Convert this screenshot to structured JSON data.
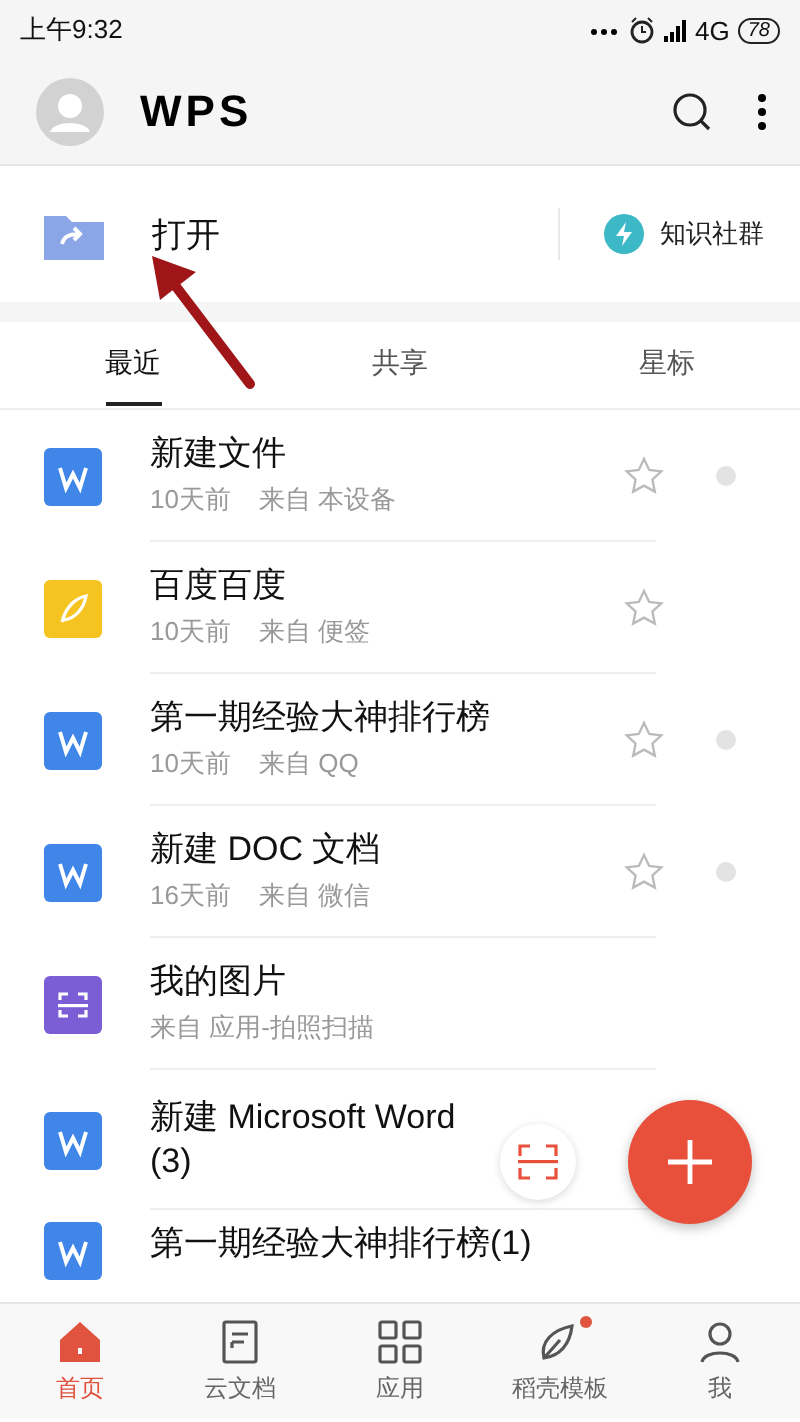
{
  "status_bar": {
    "time": "上午9:32",
    "network": "4G",
    "battery": "78"
  },
  "header": {
    "logo": "WPS"
  },
  "open_row": {
    "label": "打开",
    "community": "知识社群"
  },
  "tabs": [
    {
      "label": "最近",
      "selected": true
    },
    {
      "label": "共享",
      "selected": false
    },
    {
      "label": "星标",
      "selected": false
    }
  ],
  "files": [
    {
      "kind": "writer",
      "title": [
        "新建文件"
      ],
      "time": "10天前",
      "source": "来自 本设备",
      "star_button": true,
      "status_dot": true
    },
    {
      "kind": "note",
      "title": [
        "百度百度"
      ],
      "time": "10天前",
      "source": "来自 便签",
      "star_button": true,
      "status_dot": false
    },
    {
      "kind": "writer",
      "title": [
        "第一期经验大神排行榜"
      ],
      "time": "10天前",
      "source": "来自 QQ",
      "star_button": true,
      "status_dot": true
    },
    {
      "kind": "writer",
      "title": [
        "新建 DOC 文档"
      ],
      "time": "16天前",
      "source": "来自 微信",
      "star_button": true,
      "status_dot": true
    },
    {
      "kind": "scan",
      "title": [
        "我的图片"
      ],
      "source": "来自 应用-拍照扫描",
      "star_button": false,
      "status_dot": false
    },
    {
      "kind": "writer",
      "title": [
        "新建 Microsoft Word",
        "(3)"
      ],
      "star_button": false,
      "status_dot": false
    },
    {
      "kind": "writer",
      "title": [
        "第一期经验大神排行榜(1)"
      ],
      "star_button": false,
      "status_dot": false
    }
  ],
  "bottom_nav": [
    {
      "kind": "home",
      "label": "首页",
      "selected": true,
      "badge": false
    },
    {
      "kind": "cloud",
      "label": "云文档",
      "selected": false,
      "badge": false
    },
    {
      "kind": "apps",
      "label": "应用",
      "selected": false,
      "badge": false
    },
    {
      "kind": "template",
      "label": "稻壳模板",
      "selected": false,
      "badge": true
    },
    {
      "kind": "me",
      "label": "我",
      "selected": false,
      "badge": false
    }
  ]
}
